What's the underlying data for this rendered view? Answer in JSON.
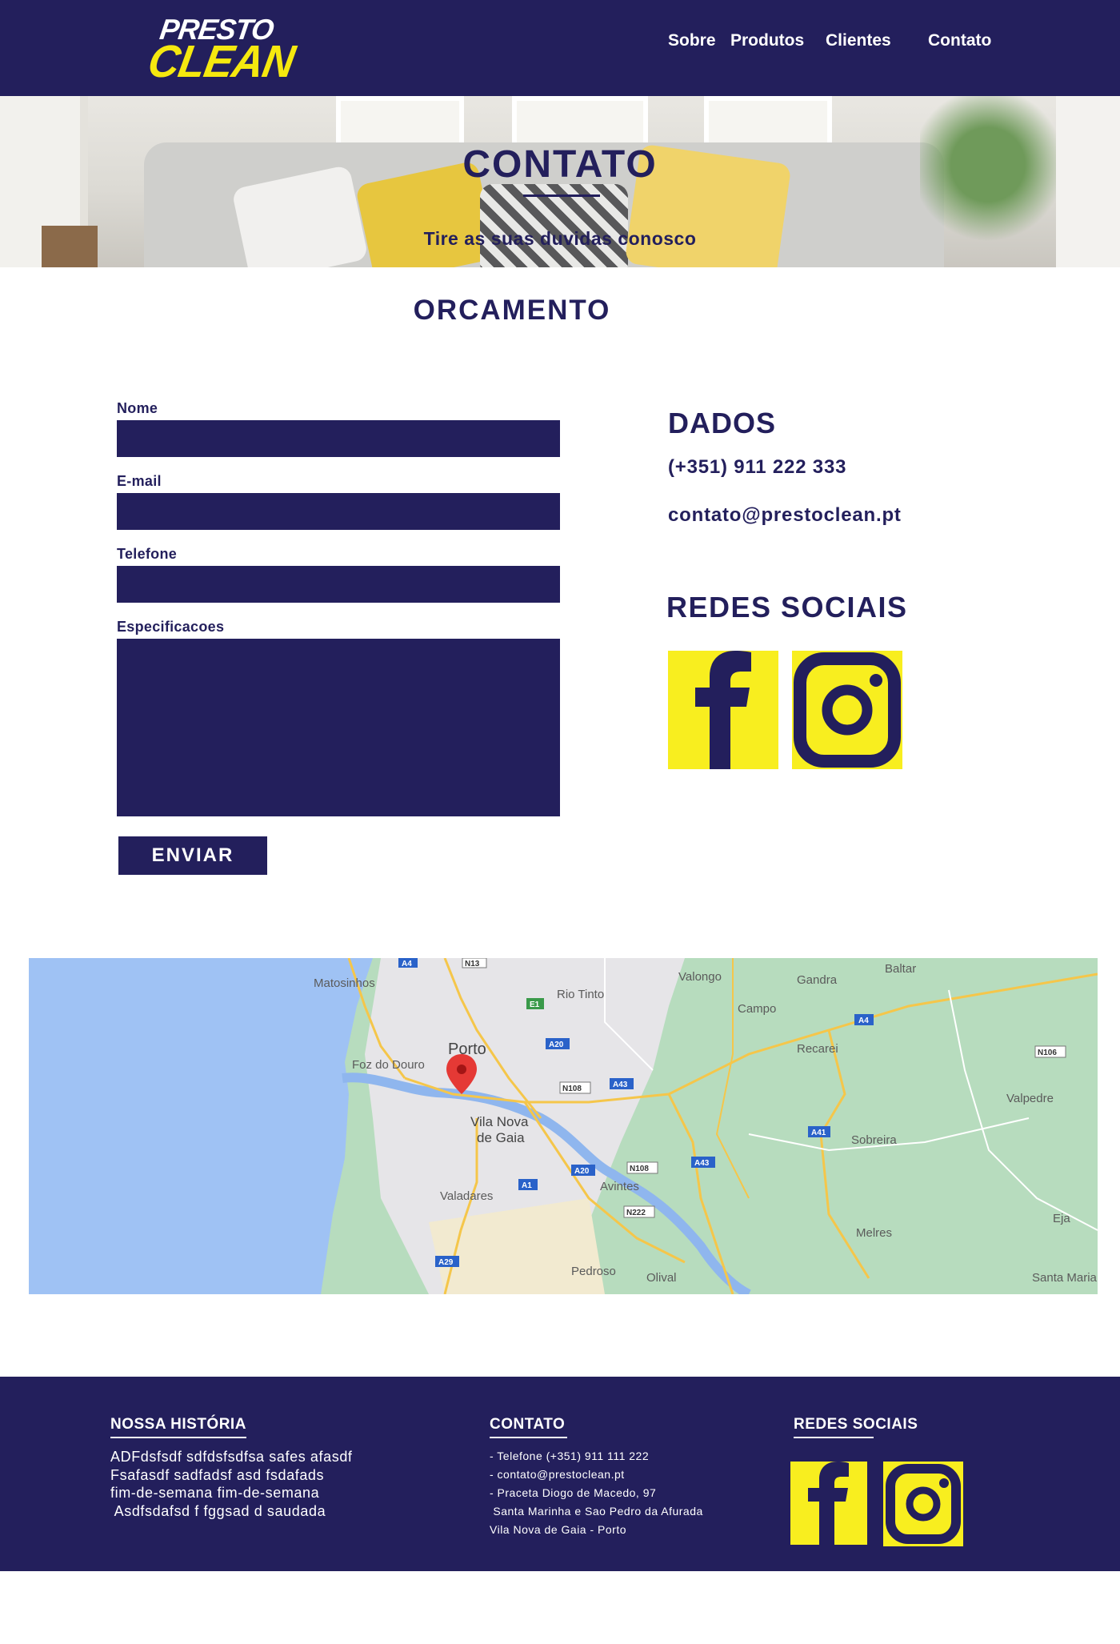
{
  "brand": {
    "logo_line1": "PRESTO",
    "logo_line2": "CLEAN"
  },
  "nav": {
    "items": [
      "Sobre",
      "Produtos",
      "Clientes",
      "Contato"
    ]
  },
  "hero": {
    "title": "CONTATO",
    "subtitle": "Tire as suas duvidas conosco"
  },
  "form": {
    "section_title": "ORCAMENTO",
    "fields": [
      {
        "label": "Nome",
        "value": ""
      },
      {
        "label": "E-mail",
        "value": ""
      },
      {
        "label": "Telefone",
        "value": ""
      },
      {
        "label": "Especificacoes",
        "value": ""
      }
    ],
    "submit_label": "ENVIAR"
  },
  "dados": {
    "title": "DADOS",
    "phone": "(+351) 911 222 333",
    "email": "contato@prestoclean.pt",
    "social_title": "REDES SOCIAIS"
  },
  "map": {
    "labels": [
      "Matosinhos",
      "Rio Tinto",
      "Valongo",
      "Gandra",
      "Baltar",
      "Campo",
      "Recarei",
      "Porto",
      "Foz do Douro",
      "Vila Nova",
      "de Gaia",
      "Valpedre",
      "Sobreira",
      "Avintes",
      "Valadares",
      "Melres",
      "Pedroso",
      "Olival",
      "Santa Maria",
      "Eja"
    ],
    "road_badges": [
      "A4",
      "N13",
      "E1",
      "A20",
      "N108",
      "A43",
      "A4",
      "N106",
      "A41",
      "N108",
      "A43",
      "A20",
      "A1",
      "N222",
      "A29"
    ]
  },
  "footer": {
    "history_title": "NOSSA HISTÓRIA",
    "history_text": "ADFdsfsdf sdfdsfsdfsa safes afasdf\nFsafasdf sadfadsf asd fsdafads\nfim-de-semana fim-de-semana\n Asdfsdafsd f fggsad d saudada",
    "contact_title": "CONTATO",
    "contact_text": "- Telefone (+351) 911 111 222\n- contato@prestoclean.pt\n- Praceta Diogo de Macedo, 97\n Santa Marinha e Sao Pedro da Afurada\nVila Nova de Gaia - Porto",
    "social_title": "REDES SOCIAIS"
  },
  "colors": {
    "navy": "#231f5c",
    "yellow": "#f8ee1f",
    "white": "#ffffff"
  },
  "icons": [
    "facebook-icon",
    "instagram-icon",
    "map-pin-icon"
  ]
}
